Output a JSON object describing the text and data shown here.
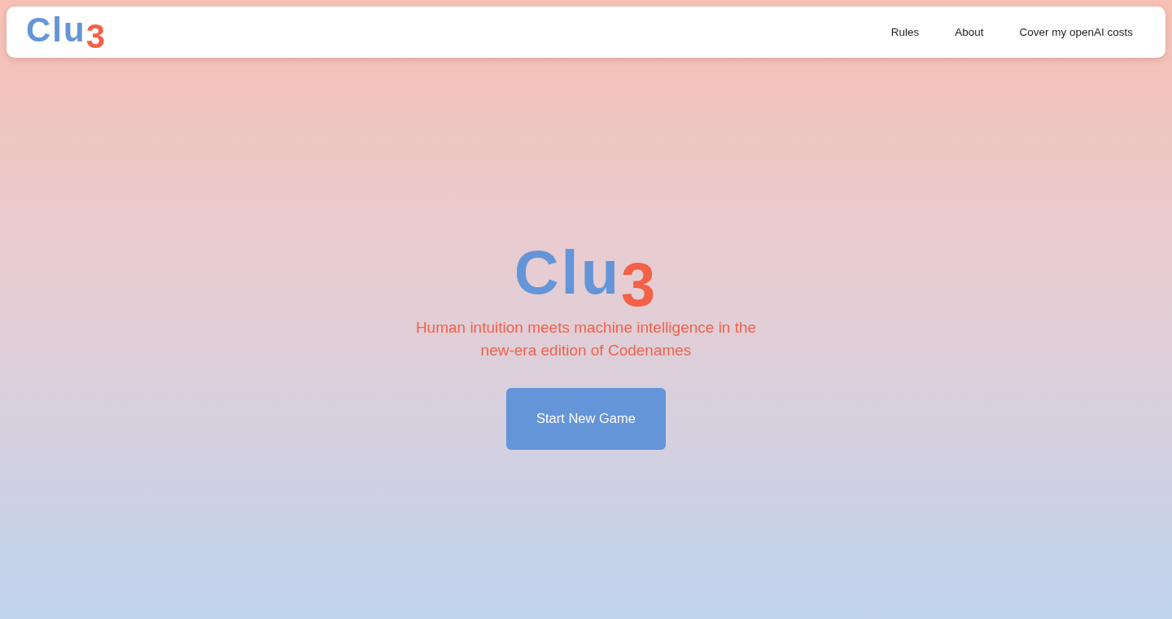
{
  "header": {
    "logo": "Clu$_{3}$",
    "nav": [
      "Rules",
      "About",
      "Cover my openAI costs"
    ]
  },
  "hero": {
    "logo": "Clu$_{3}$",
    "tagline": "Human intuition meets machine intelligence in the new-era edition of Codenames",
    "button": "Start New Game"
  }
}
